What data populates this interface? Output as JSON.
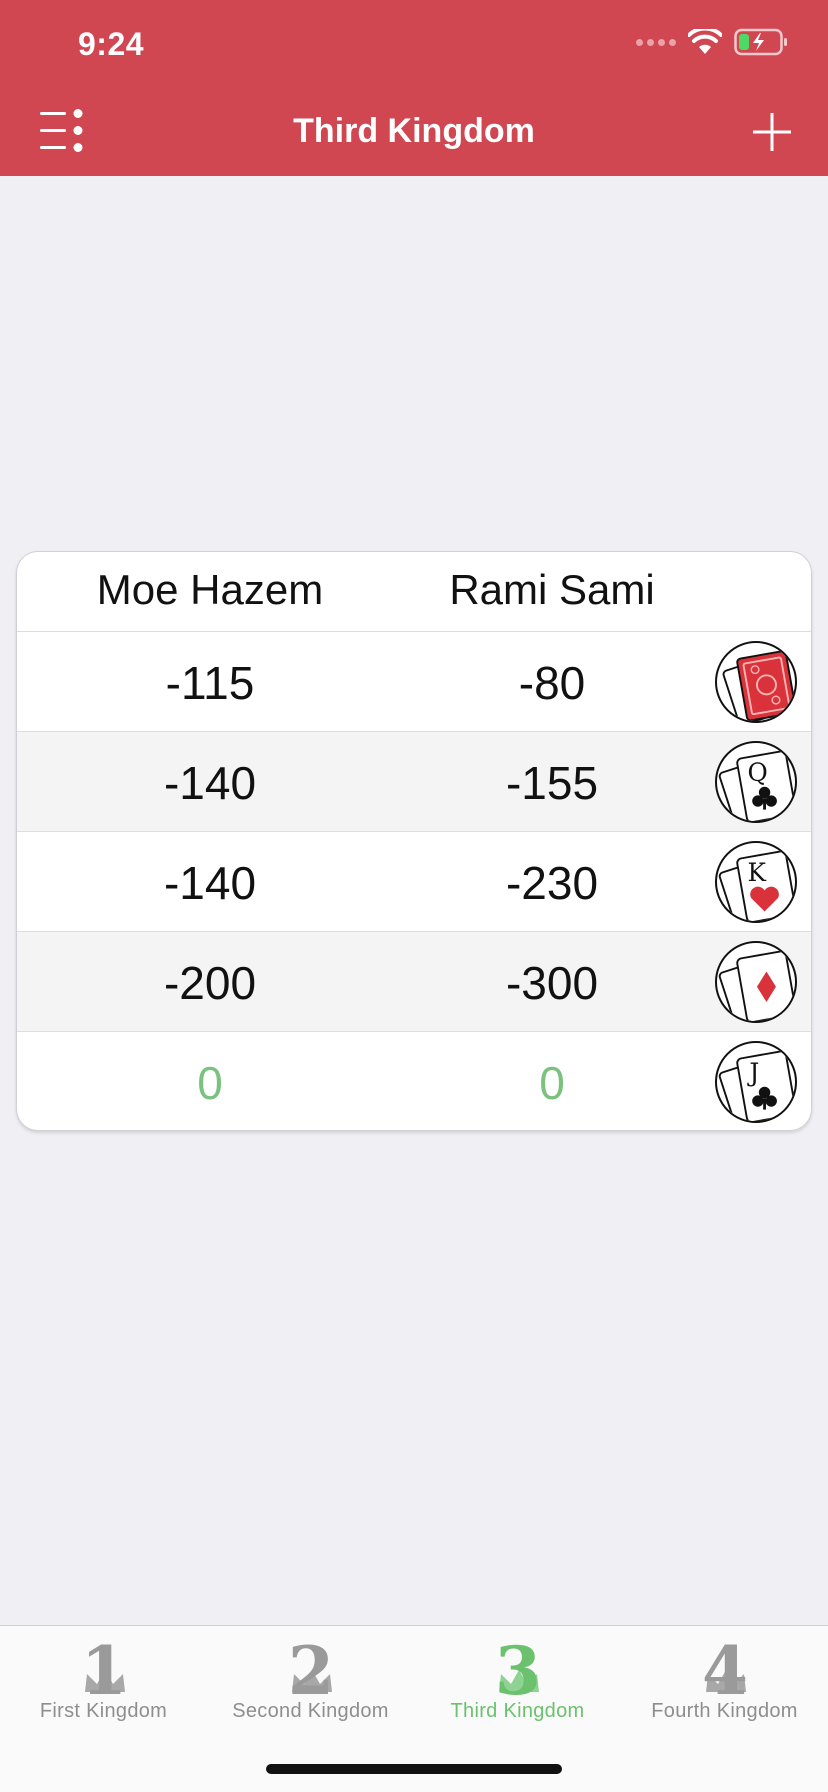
{
  "status_bar": {
    "time": "9:24",
    "icons": [
      "signal-dots-icon",
      "wifi-icon",
      "battery-charging-icon"
    ]
  },
  "nav": {
    "title": "Third Kingdom",
    "left_icon": "menu-icon",
    "right_icon": "plus-icon"
  },
  "colors": {
    "header": "#d04752",
    "positive": "#7bc27e",
    "tab_active": "#6cc16f",
    "tab_inactive": "#8e8e8e",
    "background": "#efeff4"
  },
  "score_table": {
    "players": [
      "Moe Hazem",
      "Rami Sami"
    ],
    "rows": [
      {
        "scores": [
          "-115",
          "-80"
        ],
        "icon": "card-back-icon",
        "positive": false
      },
      {
        "scores": [
          "-140",
          "-155"
        ],
        "icon": "queen-of-clubs-icon",
        "positive": false
      },
      {
        "scores": [
          "-140",
          "-230"
        ],
        "icon": "king-of-hearts-icon",
        "positive": false
      },
      {
        "scores": [
          "-200",
          "-300"
        ],
        "icon": "diamonds-icon",
        "positive": false
      },
      {
        "scores": [
          "0",
          "0"
        ],
        "icon": "jack-of-clubs-icon",
        "positive": true
      }
    ]
  },
  "tabs": [
    {
      "label": "First Kingdom",
      "number": "1",
      "active": false
    },
    {
      "label": "Second Kingdom",
      "number": "2",
      "active": false
    },
    {
      "label": "Third Kingdom",
      "number": "3",
      "active": true
    },
    {
      "label": "Fourth Kingdom",
      "number": "4",
      "active": false
    }
  ]
}
